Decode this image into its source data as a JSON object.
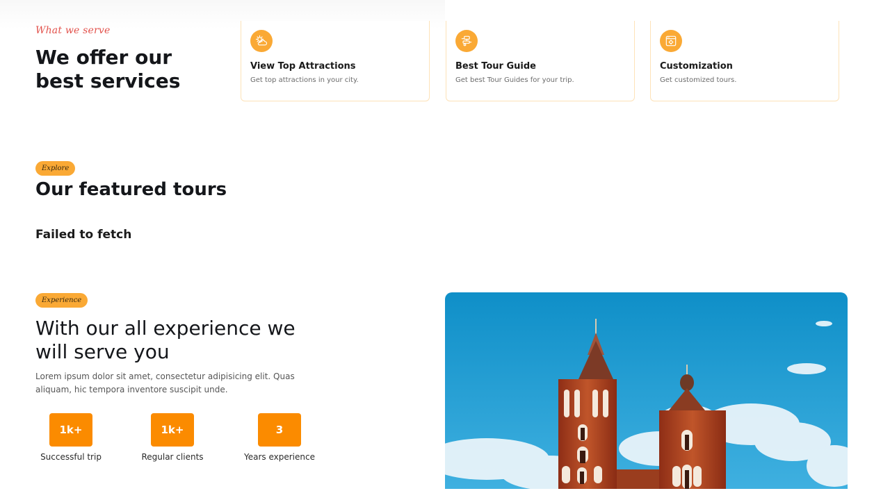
{
  "services": {
    "subtitle": "What we serve",
    "title": "We offer our best services",
    "cards": [
      {
        "icon": "weather-icon",
        "title": "View Top Attractions",
        "desc": "Get top attractions in your city."
      },
      {
        "icon": "guide-icon",
        "title": "Best Tour Guide",
        "desc": "Get best Tour Guides for your trip."
      },
      {
        "icon": "customize-icon",
        "title": "Customization",
        "desc": "Get customized tours."
      }
    ]
  },
  "featured": {
    "badge": "Explore",
    "title": "Our featured tours",
    "error": "Failed to fetch"
  },
  "experience": {
    "badge": "Experience",
    "title": "With our all experience we will serve you",
    "desc": "Lorem ipsum dolor sit amet, consectetur adipisicing elit. Quas aliquam, hic tempora inventore suscipit unde.",
    "stats": [
      {
        "value": "1k+",
        "label": "Successful trip"
      },
      {
        "value": "1k+",
        "label": "Regular clients"
      },
      {
        "value": "3",
        "label": "Years experience"
      }
    ]
  },
  "colors": {
    "accent": "#faa935",
    "stat": "#fb8b00",
    "script": "#e2514b"
  }
}
